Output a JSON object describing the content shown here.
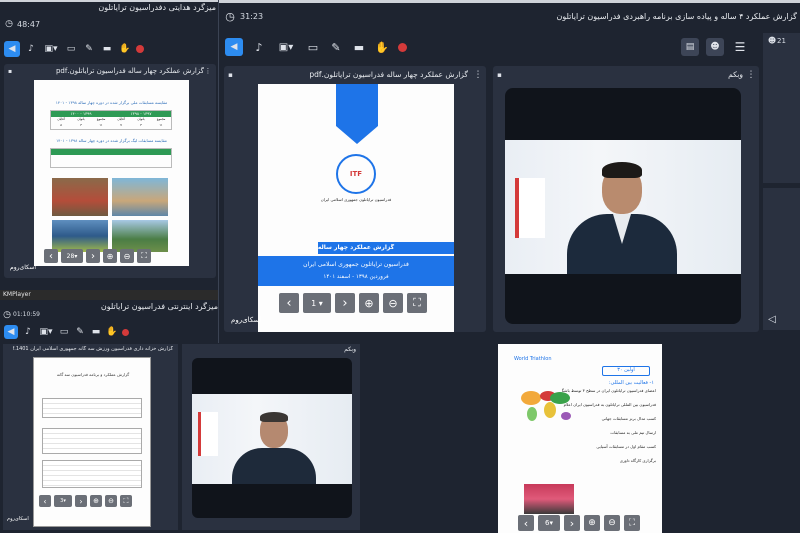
{
  "kmplayer_label": "KMPlayer",
  "window_back1": {
    "title": "میزگرد هدایتی دفدراسیون ترایاتلون",
    "timer": "48:47",
    "pdf_panel_title": "گزارش عملکرد چهار ساله فدراسیون ترایاتلون.pdf",
    "pdf_page": "28",
    "doc_title_1": "مقایسه مسابقات ملی برگزار شده در دوره چهار ساله ۱۳۹۸ - ۱۴۰۱",
    "doc_years_1": "۱۴۰۰ - ۱۳۹۹",
    "doc_years_2": "۱۳۹۸ - ۱۳۹۷",
    "doc_title_2": "مقایسه مسابقات لیگ برگزار شده در دوره چهار ساله ۱۳۹۸ - ۱۴۰۱",
    "table_head": [
      "آقایان",
      "بانوان",
      "مجموع",
      "آقایان",
      "بانوان",
      "مجموع"
    ],
    "table_row": [
      "۸",
      "۳",
      "۱۱",
      "۷",
      "۴",
      "۱۱"
    ],
    "watermark": "اسکای‌روم"
  },
  "window_back2": {
    "title": "میزگرد اینترنتی فدراسیون ترایاتلون",
    "timer": "01:10:59",
    "pdf_panel_title": "گزارش خزانه داری فدراسیون ورزش سه گانه جمهوری اسلامی ایران 1401.pdf",
    "webcam_title": "وبکم",
    "pdf_page": "3",
    "doc_heading": "گزارش عملکرد و برنامه فدراسیون سه گانه",
    "watermark": "اسکای‌روم"
  },
  "window_main": {
    "title": "گزارش عملکرد ۴ ساله و پیاده سازی برنامه راهبردی فدراسیون ترایاتلون",
    "timer": "31:23",
    "participants_count": "21",
    "pdf_panel_title": "گزارش عملکرد چهار ساله فدراسیون ترایاتلون.pdf",
    "webcam_title": "وبکم",
    "pdf_page": "1",
    "logo_text": "فدراسیون ترایاتلون جمهوری اسلامی ایران",
    "logo_brand": "ITF",
    "cover_title_1": "گزارش عملکرد چهار ساله",
    "cover_title_2": "فدراسیون ترایاتلون جمهوری اسلامی ایران",
    "cover_title_3": "فروردین ۱۳۹۸ - اسفند ۱۴۰۱",
    "watermark": "اسکای‌روم"
  },
  "bottom_right_doc": {
    "pdf_page": "6",
    "brand": "World Triathlon",
    "section_label": "اولین ۳۰",
    "heading": "۱- فعالیت بین المللی:",
    "bullets": [
      "اعضای فدراسیون ترایاتلون ایران در سطح ۳ توسط باشگاه ترایاتلون جهانی و آسیایی در ماه",
      "فدراسیون بین المللی ترایاتلون به فدراسیون ایران اعلام",
      "کسب مدال برنز مسابقات جهانی",
      "ارسال تیم ملی به مسابقات",
      "کسب مقام اول در مسابقات آسیایی",
      "برگزاری کارگاه داوری"
    ],
    "watermark": "اسکای‌روم"
  },
  "colors": {
    "dark_bg": "#1e2430",
    "panel_bg": "#2a3140",
    "accent_blue": "#1e74e8",
    "record_red": "#d43a3a",
    "active_blue": "#2d8cf0"
  }
}
